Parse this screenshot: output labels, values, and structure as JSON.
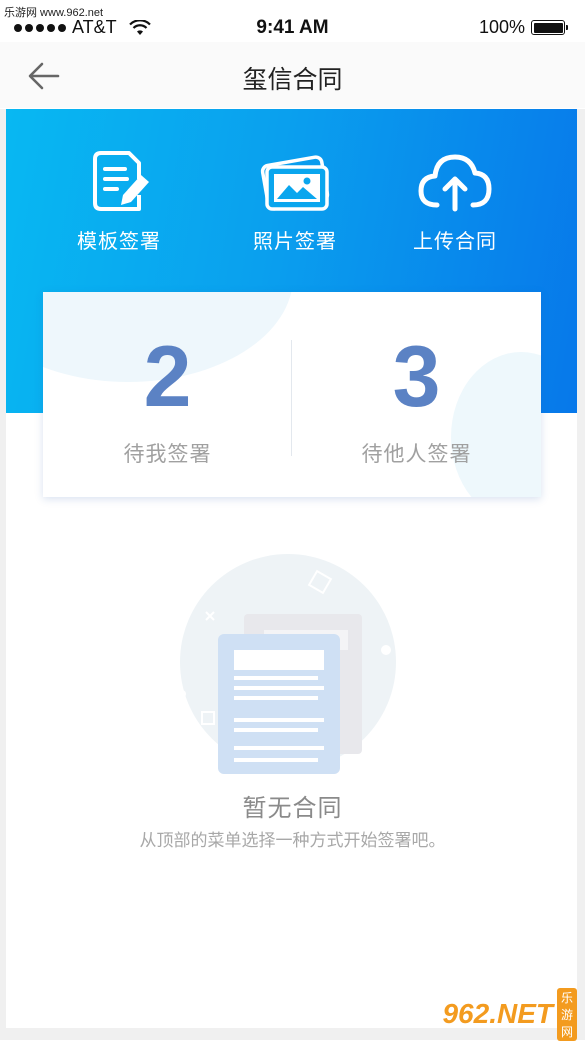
{
  "watermark": {
    "site_text": "乐游网 www.962.net",
    "brand_number": "962.NET",
    "brand_sub": "乐游网"
  },
  "status_bar": {
    "carrier": "AT&T",
    "time": "9:41 AM",
    "battery": "100%"
  },
  "nav": {
    "title": "玺信合同",
    "back_icon": "arrow-left-icon"
  },
  "actions": [
    {
      "label": "模板签署",
      "icon": "document-pen-icon"
    },
    {
      "label": "照片签署",
      "icon": "photo-icon"
    },
    {
      "label": "上传合同",
      "icon": "cloud-upload-icon"
    }
  ],
  "stats": [
    {
      "value": "2",
      "caption": "待我签署"
    },
    {
      "value": "3",
      "caption": "待他人签署"
    }
  ],
  "empty_state": {
    "title": "暂无合同",
    "description": "从顶部的菜单选择一种方式开始签署吧。",
    "illustration": "empty-documents-icon"
  },
  "colors": {
    "banner_start": "#08b8f2",
    "banner_end": "#0778ea",
    "stat_number": "#5b82c4"
  }
}
